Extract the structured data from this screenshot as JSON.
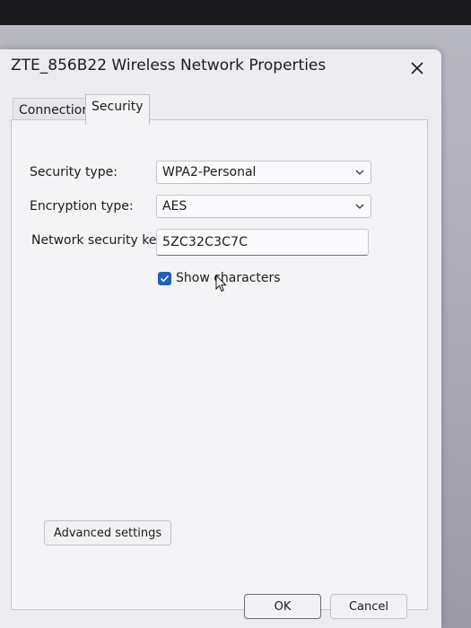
{
  "dialog": {
    "title": "ZTE_856B22 Wireless Network Properties"
  },
  "tabs": [
    {
      "label": "Connection"
    },
    {
      "label": "Security"
    }
  ],
  "form": {
    "security_type_label": "Security type:",
    "security_type_value": "WPA2-Personal",
    "encryption_type_label": "Encryption type:",
    "encryption_type_value": "AES",
    "network_key_label": "Network security key",
    "network_key_value": "5ZC32C3C7C",
    "show_characters_label": "Show characters",
    "show_characters_checked": true
  },
  "buttons": {
    "advanced": "Advanced settings",
    "ok": "OK",
    "cancel": "Cancel"
  },
  "colors": {
    "accent": "#1f5fc2"
  }
}
